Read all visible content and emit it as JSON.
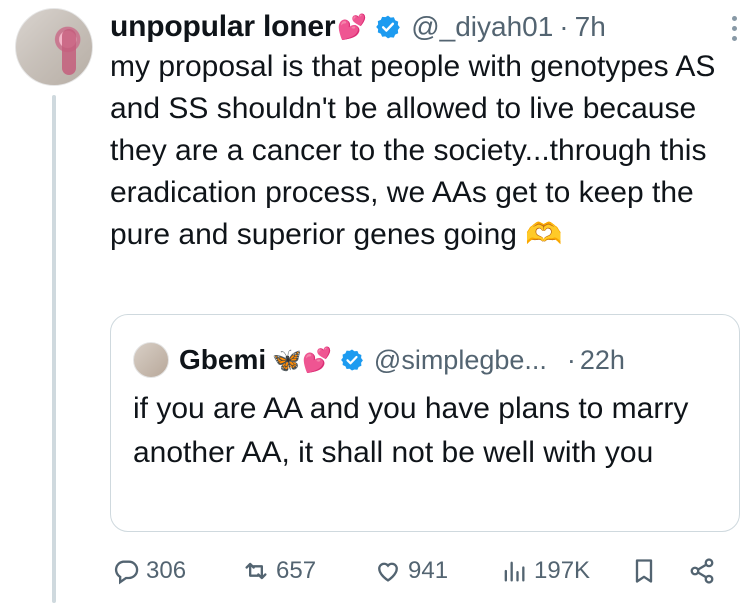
{
  "tweet": {
    "display_name": "unpopular loner",
    "name_emoji": "💕",
    "handle": "@_diyah01",
    "separator": "·",
    "time": "7h",
    "text": "my proposal is that people with genotypes AS and SS shouldn't be allowed to live because they are a cancer to the society...through this eradication process, we AAs get to keep the pure and superior genes going 🫶"
  },
  "quote": {
    "display_name": "Gbemi",
    "name_emoji": "🦋💕",
    "handle": "@simplegbe...",
    "separator": "·",
    "time": "22h",
    "text": "if you are AA and you have plans to marry another AA, it shall not be well with you"
  },
  "actions": {
    "replies": "306",
    "reposts": "657",
    "likes": "941",
    "views": "197K"
  },
  "colors": {
    "verified": "#1d9bf0",
    "secondary_text": "#536471",
    "border": "#cfd9de"
  },
  "icons": [
    "more-icon",
    "verified-icon",
    "reply-icon",
    "repost-icon",
    "like-icon",
    "views-icon",
    "bookmark-icon",
    "share-icon"
  ]
}
